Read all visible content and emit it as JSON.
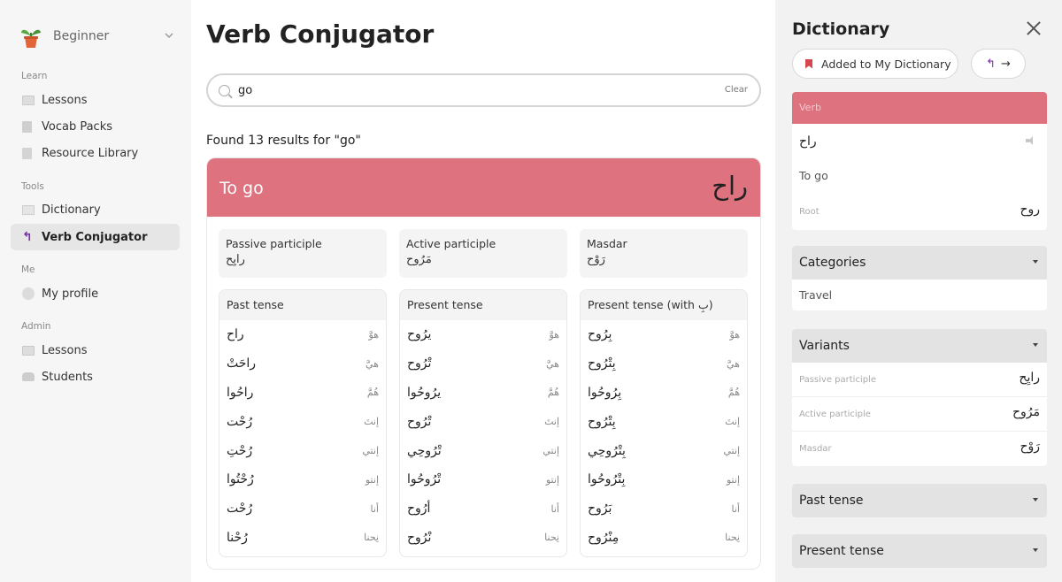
{
  "sidebar": {
    "level": "Beginner",
    "sections": [
      {
        "title": "Learn",
        "items": [
          "Lessons",
          "Vocab Packs",
          "Resource Library"
        ]
      },
      {
        "title": "Tools",
        "items": [
          "Dictionary",
          "Verb Conjugator"
        ]
      },
      {
        "title": "Me",
        "items": [
          "My profile"
        ]
      },
      {
        "title": "Admin",
        "items": [
          "Lessons",
          "Students"
        ]
      }
    ],
    "active_item": "Verb Conjugator"
  },
  "main": {
    "title": "Verb Conjugator",
    "search": {
      "value": "go",
      "clear_label": "Clear"
    },
    "results_text": "Found 13 results for \"go\"",
    "card": {
      "title": "To go",
      "arabic": "راح",
      "header_color": "#df727f",
      "participles": [
        {
          "label": "Passive participle",
          "value": "رايِح"
        },
        {
          "label": "Active participle",
          "value": "مَرُوح"
        },
        {
          "label": "Masdar",
          "value": "رَوْح"
        }
      ],
      "tenses": [
        {
          "name": "Past tense",
          "rows": [
            {
              "pronoun": "هوَّ",
              "verb": "راح"
            },
            {
              "pronoun": "هيَّ",
              "verb": "راحَتْ"
            },
            {
              "pronoun": "هُمَّ",
              "verb": "راحُوا"
            },
            {
              "pronoun": "إنتَ",
              "verb": "رُحْت"
            },
            {
              "pronoun": "إنتي",
              "verb": "رُحْتِ"
            },
            {
              "pronoun": "إنتو",
              "verb": "رُحْتُوا"
            },
            {
              "pronoun": "أنا",
              "verb": "رُحْت"
            },
            {
              "pronoun": "نِحنا",
              "verb": "رُحْنا"
            }
          ]
        },
        {
          "name": "Present tense",
          "rows": [
            {
              "pronoun": "هوَّ",
              "verb": "يرُوح"
            },
            {
              "pronoun": "هيَّ",
              "verb": "تْرُوح"
            },
            {
              "pronoun": "هُمَّ",
              "verb": "يرُوحُوا"
            },
            {
              "pronoun": "إنتَ",
              "verb": "تْرُوح"
            },
            {
              "pronoun": "إنتي",
              "verb": "تْرُوحِي"
            },
            {
              "pronoun": "إنتو",
              "verb": "تْرُوحُوا"
            },
            {
              "pronoun": "أنا",
              "verb": "أرُوح"
            },
            {
              "pronoun": "نِحنا",
              "verb": "نْرُوح"
            }
          ]
        },
        {
          "name": "Present tense (with بِ)",
          "rows": [
            {
              "pronoun": "هوَّ",
              "verb": "بِرُوح"
            },
            {
              "pronoun": "هيَّ",
              "verb": "بِتْرُوح"
            },
            {
              "pronoun": "هُمَّ",
              "verb": "بِرُوحُوا"
            },
            {
              "pronoun": "إنتَ",
              "verb": "بِتْرُوح"
            },
            {
              "pronoun": "إنتي",
              "verb": "بِتْرُوحِي"
            },
            {
              "pronoun": "إنتو",
              "verb": "بِتْرُوحُوا"
            },
            {
              "pronoun": "أنا",
              "verb": "بَرُوح"
            },
            {
              "pronoun": "نِحنا",
              "verb": "مِنْرُوح"
            }
          ]
        }
      ]
    }
  },
  "panel": {
    "title": "Dictionary",
    "added_label": "Added to My Dictionary",
    "entry": {
      "type": "Verb",
      "word": "راح",
      "meaning": "To go",
      "root_label": "Root",
      "root": "روح"
    },
    "categories": {
      "title": "Categories",
      "items": [
        "Travel"
      ]
    },
    "variants": {
      "title": "Variants",
      "rows": [
        {
          "label": "Passive participle",
          "value": "رايِح"
        },
        {
          "label": "Active participle",
          "value": "مَرُوح"
        },
        {
          "label": "Masdar",
          "value": "رَوْح"
        }
      ]
    },
    "past_tense_title": "Past tense",
    "present_tense_title": "Present tense"
  }
}
